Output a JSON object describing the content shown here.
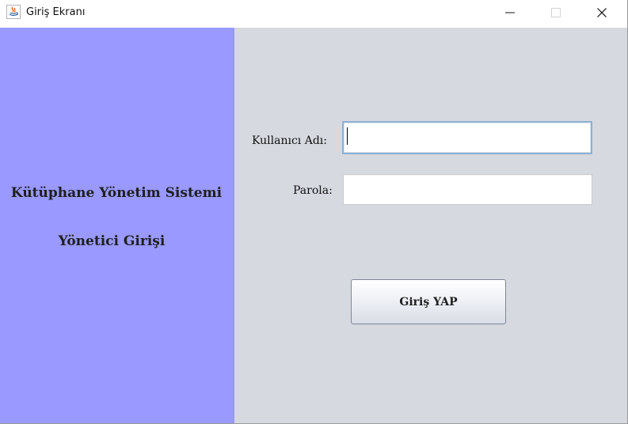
{
  "window": {
    "title": "Giriş Ekranı",
    "app_icon": "java-icon",
    "controls": [
      "minimize-icon",
      "maximize-icon",
      "close-icon"
    ]
  },
  "left_panel": {
    "system_title": "Kütüphane Yönetim Sistemi",
    "admin_login": "Yönetici Girişi"
  },
  "form": {
    "username_label": "Kullanıcı Adı:",
    "username_value": "",
    "password_label": "Parola:",
    "password_value": "",
    "login_button": "Giriş YAP"
  },
  "colors": {
    "left_panel": "#9999ff",
    "right_panel": "#d6d9e0",
    "focused_field_border": "#8fb0cf"
  }
}
